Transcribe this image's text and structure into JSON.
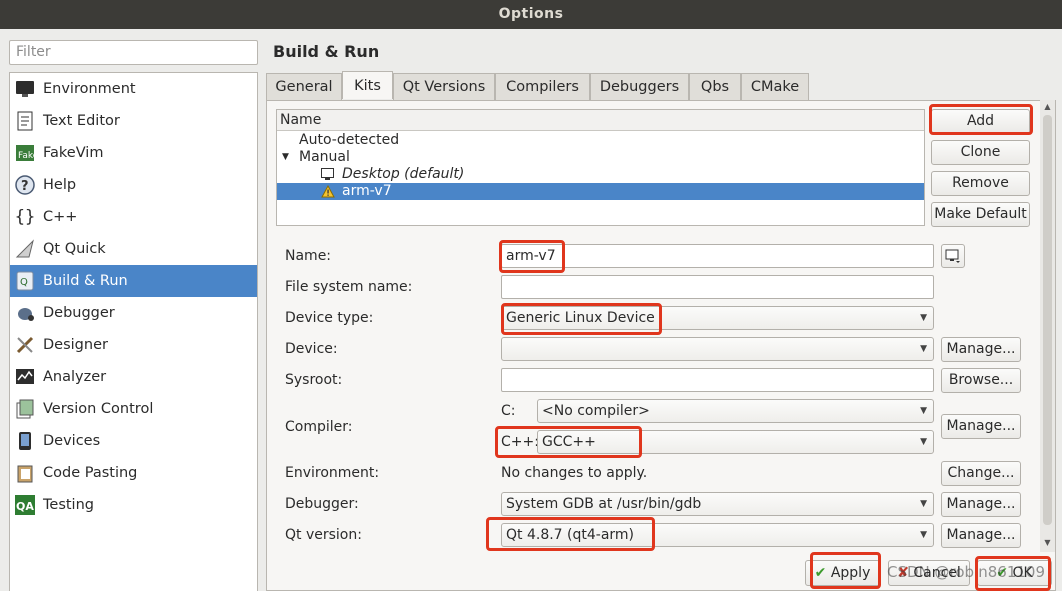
{
  "window": {
    "title": "Options"
  },
  "filter": {
    "placeholder": "Filter"
  },
  "categories": [
    {
      "label": "Environment",
      "icon": "monitor-icon",
      "selected": false
    },
    {
      "label": "Text Editor",
      "icon": "text-document-icon",
      "selected": false
    },
    {
      "label": "FakeVim",
      "icon": "fakevim-icon",
      "selected": false
    },
    {
      "label": "Help",
      "icon": "help-icon",
      "selected": false
    },
    {
      "label": "C++",
      "icon": "braces-icon",
      "selected": false
    },
    {
      "label": "Qt Quick",
      "icon": "qtquick-icon",
      "selected": false
    },
    {
      "label": "Build & Run",
      "icon": "build-run-icon",
      "selected": true
    },
    {
      "label": "Debugger",
      "icon": "bug-icon",
      "selected": false
    },
    {
      "label": "Designer",
      "icon": "designer-brush-icon",
      "selected": false
    },
    {
      "label": "Analyzer",
      "icon": "analyzer-icon",
      "selected": false
    },
    {
      "label": "Version Control",
      "icon": "version-control-icon",
      "selected": false
    },
    {
      "label": "Devices",
      "icon": "device-icon",
      "selected": false
    },
    {
      "label": "Code Pasting",
      "icon": "clipboard-icon",
      "selected": false
    },
    {
      "label": "Testing",
      "icon": "qa-icon",
      "selected": false
    }
  ],
  "page": {
    "title": "Build & Run"
  },
  "tabs": [
    "General",
    "Kits",
    "Qt Versions",
    "Compilers",
    "Debuggers",
    "Qbs",
    "CMake"
  ],
  "selected_tab": "Kits",
  "kits_tree": {
    "header": "Name",
    "auto_detected": "Auto-detected",
    "manual": "Manual",
    "desktop": "Desktop (default)",
    "arm": "arm-v7"
  },
  "kit_buttons": {
    "add": "Add",
    "clone": "Clone",
    "remove": "Remove",
    "make_default": "Make Default"
  },
  "form": {
    "name_label": "Name:",
    "name_value": "arm-v7",
    "fs_label": "File system name:",
    "fs_value": "",
    "device_type_label": "Device type:",
    "device_type_value": "Generic Linux Device",
    "device_label": "Device:",
    "device_value": "",
    "sysroot_label": "Sysroot:",
    "sysroot_value": "",
    "compiler_label": "Compiler:",
    "c_label": "C:",
    "c_value": "<No compiler>",
    "cpp_label": "C++:",
    "cpp_value": "GCC++",
    "env_label": "Environment:",
    "env_value": "No changes to apply.",
    "debugger_label": "Debugger:",
    "debugger_value": "System GDB at /usr/bin/gdb",
    "qt_label": "Qt version:",
    "qt_value": "Qt 4.8.7 (qt4-arm)"
  },
  "side_buttons": {
    "manage": "Manage...",
    "browse": "Browse...",
    "change": "Change..."
  },
  "dialog_buttons": {
    "apply": "Apply",
    "cancel": "Cancel",
    "ok": "OK"
  },
  "watermark": "CSDN @robin861109",
  "colors": {
    "selection": "#4a85c8",
    "highlight": "#e0361d",
    "titlebar": "#3c3b37"
  }
}
